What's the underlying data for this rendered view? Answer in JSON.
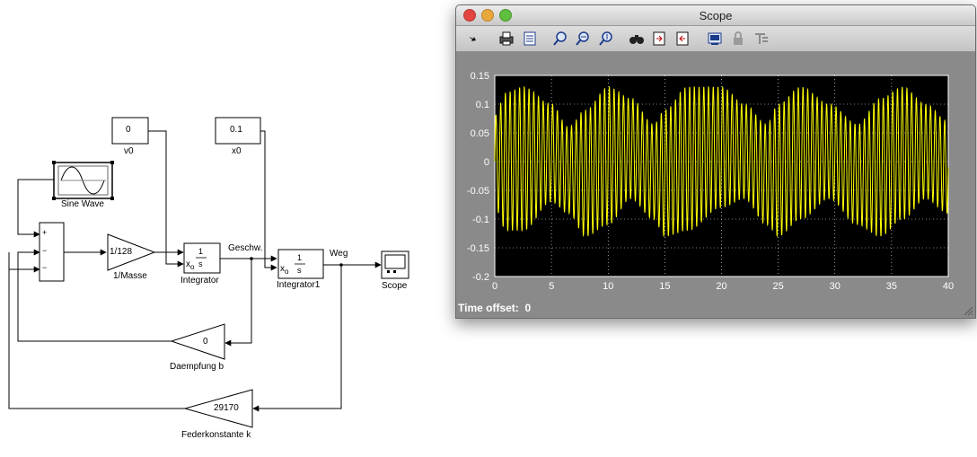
{
  "model": {
    "blocks": {
      "v0": {
        "value": "0",
        "name": "v0"
      },
      "x0": {
        "value": "0.1",
        "name": "x0"
      },
      "sine": {
        "name": "Sine Wave"
      },
      "sum": {
        "signs": [
          "+",
          "−",
          "−"
        ]
      },
      "gain_mass": {
        "value": "1/128",
        "name": "1/Masse"
      },
      "integrator": {
        "num": "1",
        "den": "s",
        "x0": "x",
        "x0_sub": "o",
        "name": "Integrator"
      },
      "integrator1": {
        "num": "1",
        "den": "s",
        "x0": "x",
        "x0_sub": "o",
        "name": "Integrator1"
      },
      "scope": {
        "name": "Scope"
      },
      "damping": {
        "value": "0",
        "name": "Daempfung b"
      },
      "spring": {
        "value": "29170",
        "name": "Federkonstante k"
      }
    },
    "signals": {
      "velocity": "Geschw.",
      "position": "Weg"
    }
  },
  "scope_window": {
    "title": "Scope",
    "toolbar_icons": [
      "arrow-icon",
      "print-icon",
      "params-icon",
      "zoom-icon",
      "zoom-x-icon",
      "zoom-y-icon",
      "autoscale-icon",
      "save-axes-icon",
      "restore-axes-icon",
      "floating-scope-icon",
      "lock-icon",
      "signal-selection-icon"
    ],
    "time_offset_label": "Time offset:",
    "time_offset_value": "0",
    "colors": {
      "window_bg": "#8a8a8a",
      "axes_bg": "#000000",
      "trace": "#ffff00",
      "grid": "#ffffff"
    }
  },
  "chart_data": {
    "type": "line",
    "title": "",
    "xlabel": "",
    "ylabel": "",
    "xlim": [
      0,
      40
    ],
    "ylim": [
      -0.2,
      0.15
    ],
    "xticks": [
      0,
      5,
      10,
      15,
      20,
      25,
      30,
      35,
      40
    ],
    "yticks": [
      0.15,
      0.1,
      0.05,
      0,
      -0.05,
      -0.1,
      -0.15,
      -0.2
    ],
    "xtick_labels": [
      "0",
      "5",
      "10",
      "15",
      "20",
      "25",
      "30",
      "35",
      "40"
    ],
    "ytick_labels": [
      "0.15",
      "0.1",
      "0.05",
      "0",
      "-0.05",
      "-0.1",
      "-0.15",
      "-0.2"
    ],
    "grid": true,
    "series": [
      {
        "oscillation_frequency_hz": 2.4,
        "envelope_t": [
          0,
          1,
          2.5,
          5,
          6.5,
          8,
          10,
          12,
          14,
          15,
          17,
          20,
          22,
          24,
          25,
          27,
          29.5,
          32,
          34,
          36,
          38,
          40
        ],
        "envelope_upper": [
          0.08,
          0.12,
          0.13,
          0.1,
          0.06,
          0.09,
          0.13,
          0.11,
          0.065,
          0.09,
          0.13,
          0.13,
          0.1,
          0.065,
          0.1,
          0.13,
          0.1,
          0.065,
          0.11,
          0.13,
          0.1,
          0.07
        ],
        "envelope_lower": [
          -0.08,
          -0.12,
          -0.12,
          -0.07,
          -0.09,
          -0.13,
          -0.11,
          -0.065,
          -0.1,
          -0.13,
          -0.12,
          -0.08,
          -0.065,
          -0.11,
          -0.13,
          -0.1,
          -0.065,
          -0.11,
          -0.13,
          -0.1,
          -0.065,
          -0.09
        ]
      }
    ]
  }
}
